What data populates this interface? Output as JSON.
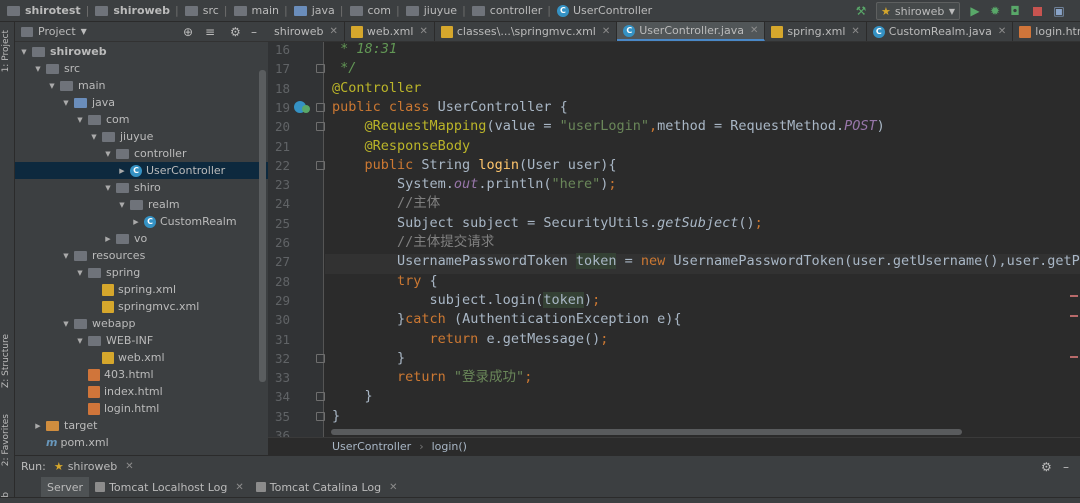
{
  "breadcrumb": [
    "shirotest",
    "shiroweb",
    "src",
    "main",
    "java",
    "com",
    "jiuyue",
    "controller",
    "UserController"
  ],
  "toolbar": {
    "run_config": "shiroweb"
  },
  "left_strip": {
    "project": "1: Project",
    "structure": "Z: Structure",
    "favorites": "2: Favorites",
    "web": "Web"
  },
  "project_panel": {
    "title": "Project"
  },
  "tree": [
    {
      "label": "shiroweb",
      "depth": 0,
      "icon": "module-folder",
      "arrow": "down",
      "bold": true
    },
    {
      "label": "src",
      "depth": 1,
      "icon": "folder",
      "arrow": "down"
    },
    {
      "label": "main",
      "depth": 2,
      "icon": "folder",
      "arrow": "down"
    },
    {
      "label": "java",
      "depth": 3,
      "icon": "source-folder",
      "arrow": "down"
    },
    {
      "label": "com",
      "depth": 4,
      "icon": "package",
      "arrow": "down"
    },
    {
      "label": "jiuyue",
      "depth": 5,
      "icon": "package",
      "arrow": "down"
    },
    {
      "label": "controller",
      "depth": 6,
      "icon": "package",
      "arrow": "down"
    },
    {
      "label": "UserController",
      "depth": 7,
      "icon": "class",
      "arrow": "right",
      "selected": true
    },
    {
      "label": "shiro",
      "depth": 6,
      "icon": "package",
      "arrow": "down"
    },
    {
      "label": "realm",
      "depth": 7,
      "icon": "package",
      "arrow": "down"
    },
    {
      "label": "CustomRealm",
      "depth": 8,
      "icon": "class",
      "arrow": "right"
    },
    {
      "label": "vo",
      "depth": 6,
      "icon": "package",
      "arrow": "right"
    },
    {
      "label": "resources",
      "depth": 3,
      "icon": "resource-folder",
      "arrow": "down"
    },
    {
      "label": "spring",
      "depth": 4,
      "icon": "package",
      "arrow": "down"
    },
    {
      "label": "spring.xml",
      "depth": 5,
      "icon": "xml"
    },
    {
      "label": "springmvc.xml",
      "depth": 5,
      "icon": "xml"
    },
    {
      "label": "webapp",
      "depth": 3,
      "icon": "web-folder",
      "arrow": "down"
    },
    {
      "label": "WEB-INF",
      "depth": 4,
      "icon": "package",
      "arrow": "down"
    },
    {
      "label": "web.xml",
      "depth": 5,
      "icon": "xml"
    },
    {
      "label": "403.html",
      "depth": 4,
      "icon": "html"
    },
    {
      "label": "index.html",
      "depth": 4,
      "icon": "html"
    },
    {
      "label": "login.html",
      "depth": 4,
      "icon": "html"
    },
    {
      "label": "target",
      "depth": 1,
      "icon": "target-folder",
      "arrow": "right"
    },
    {
      "label": "pom.xml",
      "depth": 1,
      "icon": "pom"
    }
  ],
  "tabs": [
    {
      "label": "shiroweb",
      "icon": "none"
    },
    {
      "label": "web.xml",
      "icon": "xml"
    },
    {
      "label": "classes\\...\\springmvc.xml",
      "icon": "xml"
    },
    {
      "label": "UserController.java",
      "icon": "class",
      "active": true
    },
    {
      "label": "spring.xml",
      "icon": "xml"
    },
    {
      "label": "CustomRealm.java",
      "icon": "class"
    },
    {
      "label": "login.html",
      "icon": "html"
    }
  ],
  "line_numbers": [
    "16",
    "17",
    "18",
    "19",
    "20",
    "21",
    "22",
    "23",
    "24",
    "25",
    "26",
    "27",
    "28",
    "29",
    "30",
    "31",
    "32",
    "33",
    "34",
    "35",
    "36"
  ],
  "code_lines": [
    [
      {
        "t": " * 18:31",
        "c": "cm"
      }
    ],
    [
      {
        "t": " */",
        "c": "cm"
      }
    ],
    [
      {
        "t": "@Controller",
        "c": "a"
      }
    ],
    [
      {
        "t": "public class ",
        "c": "k"
      },
      {
        "t": "UserController {",
        "c": ""
      }
    ],
    [
      {
        "t": "    @RequestMapping",
        "c": "a"
      },
      {
        "t": "(value = ",
        "c": ""
      },
      {
        "t": "\"userLogin\"",
        "c": "s"
      },
      {
        "t": ",",
        "c": "k"
      },
      {
        "t": "method = RequestMethod.",
        "c": ""
      },
      {
        "t": "POST",
        "c": "pc"
      },
      {
        "t": ")",
        "c": ""
      }
    ],
    [
      {
        "t": "    @ResponseBody",
        "c": "a"
      }
    ],
    [
      {
        "t": "    public ",
        "c": "k"
      },
      {
        "t": "String ",
        "c": ""
      },
      {
        "t": "login",
        "c": "fn"
      },
      {
        "t": "(User user){",
        "c": ""
      }
    ],
    [
      {
        "t": "        System.",
        "c": ""
      },
      {
        "t": "out",
        "c": "pc"
      },
      {
        "t": ".println(",
        "c": ""
      },
      {
        "t": "\"here\"",
        "c": "s"
      },
      {
        "t": ")",
        "c": ""
      },
      {
        "t": ";",
        "c": "k"
      }
    ],
    [
      {
        "t": "        //主体",
        "c": "c"
      }
    ],
    [
      {
        "t": "        Subject subject = SecurityUtils.",
        "c": ""
      },
      {
        "t": "getSubject",
        "c": "it"
      },
      {
        "t": "()",
        "c": ""
      },
      {
        "t": ";",
        "c": "k"
      }
    ],
    [
      {
        "t": "        //主体提交请求",
        "c": "c"
      }
    ],
    [
      {
        "t": "        UsernamePasswordToken ",
        "c": ""
      },
      {
        "t": "token",
        "c": "hlw"
      },
      {
        "t": " = ",
        "c": ""
      },
      {
        "t": "new ",
        "c": "k"
      },
      {
        "t": "UsernamePasswordToken(user.getUsername(),user.getPa",
        "c": ""
      }
    ],
    [
      {
        "t": "        try ",
        "c": "k"
      },
      {
        "t": "{",
        "c": ""
      }
    ],
    [
      {
        "t": "            subject.login(",
        "c": ""
      },
      {
        "t": "token",
        "c": "hlw"
      },
      {
        "t": ")",
        "c": ""
      },
      {
        "t": ";",
        "c": "k"
      }
    ],
    [
      {
        "t": "        }",
        "c": ""
      },
      {
        "t": "catch ",
        "c": "k"
      },
      {
        "t": "(AuthenticationException e){",
        "c": ""
      }
    ],
    [
      {
        "t": "            return ",
        "c": "k"
      },
      {
        "t": "e.getMessage()",
        "c": ""
      },
      {
        "t": ";",
        "c": "k"
      }
    ],
    [
      {
        "t": "        }",
        "c": ""
      }
    ],
    [
      {
        "t": "        return ",
        "c": "k"
      },
      {
        "t": "\"登录成功\"",
        "c": "s"
      },
      {
        "t": ";",
        "c": "k"
      }
    ],
    [
      {
        "t": "    }",
        "c": ""
      }
    ],
    [
      {
        "t": "}",
        "c": ""
      }
    ],
    [
      {
        "t": "",
        "c": ""
      }
    ]
  ],
  "editor_breadcrumb": {
    "class": "UserController",
    "method": "login()"
  },
  "run_panel": {
    "label": "Run:",
    "config": "shiroweb"
  },
  "run_tabs": [
    "Server",
    "Tomcat Localhost Log",
    "Tomcat Catalina Log"
  ],
  "colors": {
    "keyword": "#cc7832",
    "string": "#6a8759",
    "annotation": "#bbb529",
    "comment": "#808080",
    "doc": "#629755",
    "selection": "#0d293e",
    "accent": "#4a88c7"
  }
}
